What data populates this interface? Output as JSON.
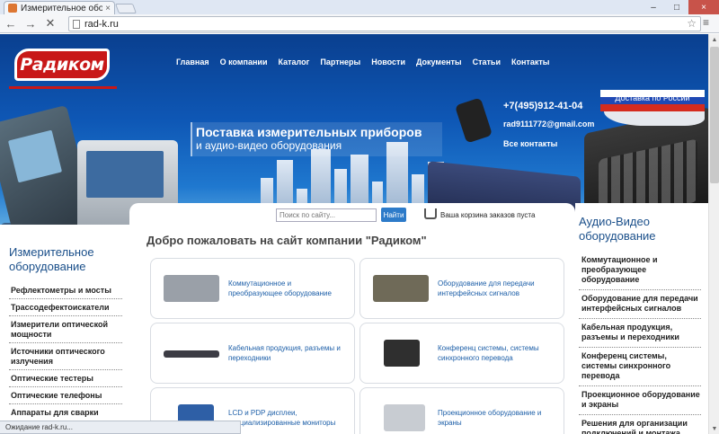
{
  "browser": {
    "tab_title": "Измерительное оборудов",
    "tab_close": "×",
    "url": "rad-k.ru",
    "window_controls": [
      "–",
      "□",
      "×"
    ],
    "status": "Ожидание rad-k.ru..."
  },
  "header": {
    "logo_text": "Радиком",
    "nav": [
      "Главная",
      "О компании",
      "Каталог",
      "Партнеры",
      "Новости",
      "Документы",
      "Статьи",
      "Контакты"
    ],
    "headline_line1": "Поставка измерительных приборов",
    "headline_line2": "и аудио-видео оборудования",
    "phone": "+7(495)912-41-04",
    "email": "rad9111772@gmail.com",
    "all_contacts": "Все контакты",
    "delivery": "Доставка по России"
  },
  "search": {
    "placeholder": "Поиск по сайту...",
    "button": "Найти"
  },
  "cart": {
    "text": "Ваша корзина заказов пуста"
  },
  "welcome": "Добро пожаловать на сайт компании \"Радиком\"",
  "left_sidebar": {
    "title": "Измерительное оборудование",
    "items": [
      "Рефлектометры и мосты",
      "Трассодефектоискатели",
      "Измерители оптической мощности",
      "Источники оптического излучения",
      "Оптические тестеры",
      "Оптические телефоны",
      "Аппараты для сварки оптического волокна"
    ]
  },
  "categories": [
    {
      "label": "Коммутационное и преобразующее оборудование",
      "img_color": "#9aa0a8"
    },
    {
      "label": "Оборудование для передачи интерфейсных сигналов",
      "img_color": "#6f6a58"
    },
    {
      "label": "Кабельная продукция, разъемы и переходники",
      "img_color": "#3c3c44"
    },
    {
      "label": "Конференц системы, системы синхронного перевода",
      "img_color": "#2f2f2f"
    },
    {
      "label": "LCD и PDP дисплеи, специализированные мониторы",
      "img_color": "#2e5fa6"
    },
    {
      "label": "Проекционное оборудование и экраны",
      "img_color": "#c8ccd2"
    }
  ],
  "right_sidebar": {
    "title": "Аудио-Видео оборудование",
    "items": [
      "Коммутационное и преобразующее оборудование",
      "Оборудование для передачи интерфейсных сигналов",
      "Кабельная продукция, разъемы и переходники",
      "Конференц системы, системы синхронного перевода",
      "Проекционное оборудование и экраны",
      "Решения для организации подключений и монтажа"
    ]
  },
  "colors": {
    "brand_red": "#c81818",
    "link_blue": "#1d5fa8",
    "banner_blue": "#0e57b5",
    "flag": [
      "#ffffff",
      "#1f49b4",
      "#d52b1e"
    ]
  }
}
